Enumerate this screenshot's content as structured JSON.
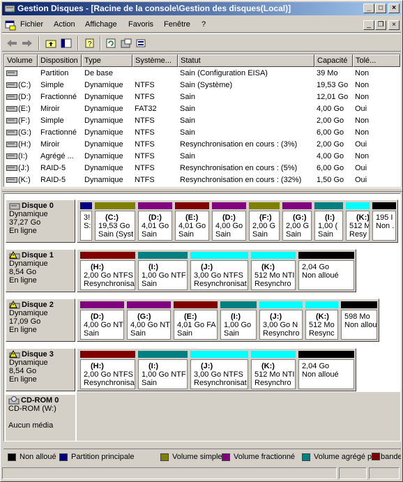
{
  "window": {
    "title": "Gestion Disques - [Racine de la console\\Gestion des disques(Local)]"
  },
  "menu": [
    "Fichier",
    "Action",
    "Affichage",
    "Favoris",
    "Fenêtre",
    "?"
  ],
  "columns": [
    "Volume",
    "Disposition",
    "Type",
    "Système...",
    "Statut",
    "Capacité",
    "Tolé..."
  ],
  "volumes": [
    {
      "volume": "",
      "disposition": "Partition",
      "type": "De base",
      "fs": "",
      "status": "Sain (Configuration EISA)",
      "capacity": "39 Mo",
      "tol": "Non"
    },
    {
      "volume": "(C:)",
      "disposition": "Simple",
      "type": "Dynamique",
      "fs": "NTFS",
      "status": "Sain (Système)",
      "capacity": "19,53 Go",
      "tol": "Non"
    },
    {
      "volume": "(D:)",
      "disposition": "Fractionné",
      "type": "Dynamique",
      "fs": "NTFS",
      "status": "Sain",
      "capacity": "12,01 Go",
      "tol": "Non"
    },
    {
      "volume": "(E:)",
      "disposition": "Miroir",
      "type": "Dynamique",
      "fs": "FAT32",
      "status": "Sain",
      "capacity": "4,00 Go",
      "tol": "Oui"
    },
    {
      "volume": "(F:)",
      "disposition": "Simple",
      "type": "Dynamique",
      "fs": "NTFS",
      "status": "Sain",
      "capacity": "2,00 Go",
      "tol": "Non"
    },
    {
      "volume": "(G:)",
      "disposition": "Fractionné",
      "type": "Dynamique",
      "fs": "NTFS",
      "status": "Sain",
      "capacity": "6,00 Go",
      "tol": "Non"
    },
    {
      "volume": "(H:)",
      "disposition": "Miroir",
      "type": "Dynamique",
      "fs": "NTFS",
      "status": "Resynchronisation en cours : (3%)",
      "capacity": "2,00 Go",
      "tol": "Oui"
    },
    {
      "volume": "(I:)",
      "disposition": "Agrégé ...",
      "type": "Dynamique",
      "fs": "NTFS",
      "status": "Sain",
      "capacity": "4,00 Go",
      "tol": "Non"
    },
    {
      "volume": "(J:)",
      "disposition": "RAID-5",
      "type": "Dynamique",
      "fs": "NTFS",
      "status": "Resynchronisation en cours : (5%)",
      "capacity": "6,00 Go",
      "tol": "Oui"
    },
    {
      "volume": "(K:)",
      "disposition": "RAID-5",
      "type": "Dynamique",
      "fs": "NTFS",
      "status": "Resynchronisation en cours : (32%)",
      "capacity": "1,50 Go",
      "tol": "Oui"
    }
  ],
  "colors": {
    "navy": "#000080",
    "olive": "#808000",
    "purple": "#800080",
    "maroon": "#800000",
    "teal": "#008080",
    "cyan": "#00ffff",
    "black": "#000000"
  },
  "disks": [
    {
      "name": "Disque 0",
      "type": "Dynamique",
      "size": "37,27 Go",
      "state": "En ligne",
      "icon": "disk-icon",
      "partitions": [
        {
          "color": "navy",
          "name": "",
          "size": "3!",
          "status": "S:"
        },
        {
          "color": "olive",
          "name": "(C:)",
          "size": "19,53 Go",
          "status": "Sain (Syst"
        },
        {
          "color": "purple",
          "name": "(D:)",
          "size": "4,01 Go",
          "status": "Sain"
        },
        {
          "color": "maroon",
          "name": "(E:)",
          "size": "4,01 Go",
          "status": "Sain"
        },
        {
          "color": "purple",
          "name": "(D:)",
          "size": "4,00 Go",
          "status": "Sain"
        },
        {
          "color": "olive",
          "name": "(F:)",
          "size": "2,00 G",
          "status": "Sain"
        },
        {
          "color": "purple",
          "name": "(G:)",
          "size": "2,00 G",
          "status": "Sain"
        },
        {
          "color": "teal",
          "name": "(I:)",
          "size": "1,00 (",
          "status": "Sain"
        },
        {
          "color": "cyan",
          "name": "(K:)",
          "size": "512 M",
          "status": "Resy"
        },
        {
          "color": "black",
          "name": "",
          "size": "195 I",
          "status": "Non ."
        }
      ]
    },
    {
      "name": "Disque 1",
      "type": "Dynamique",
      "size": "8,54 Go",
      "state": "En ligne",
      "icon": "warning-disk-icon",
      "partitions": [
        {
          "color": "maroon",
          "name": "(H:)",
          "size": "2,00 Go NTFS",
          "status": "Resynchronisa"
        },
        {
          "color": "teal",
          "name": "(I:)",
          "size": "1,00 Go NTF",
          "status": "Sain"
        },
        {
          "color": "cyan",
          "name": "(J:)",
          "size": "3,00 Go NTFS",
          "status": "Resynchronisat"
        },
        {
          "color": "cyan",
          "name": "(K:)",
          "size": "512 Mo NTI",
          "status": "Resynchro"
        },
        {
          "color": "black",
          "name": "",
          "size": "2,04 Go",
          "status": "Non alloué"
        }
      ]
    },
    {
      "name": "Disque 2",
      "type": "Dynamique",
      "size": "17,09 Go",
      "state": "En ligne",
      "icon": "warning-disk-icon",
      "partitions": [
        {
          "color": "purple",
          "name": "(D:)",
          "size": "4,00 Go NT",
          "status": "Sain"
        },
        {
          "color": "purple",
          "name": "(G:)",
          "size": "4,00 Go NT",
          "status": "Sain"
        },
        {
          "color": "maroon",
          "name": "(E:)",
          "size": "4,01 Go FA",
          "status": "Sain"
        },
        {
          "color": "teal",
          "name": "(I:)",
          "size": "1,00 Go",
          "status": "Sain"
        },
        {
          "color": "cyan",
          "name": "(J:)",
          "size": "3,00 Go N",
          "status": "Resynchro"
        },
        {
          "color": "cyan",
          "name": "(K:)",
          "size": "512 Mo",
          "status": "Resync"
        },
        {
          "color": "black",
          "name": "",
          "size": "598 Mo",
          "status": "Non allou"
        }
      ]
    },
    {
      "name": "Disque 3",
      "type": "Dynamique",
      "size": "8,54 Go",
      "state": "En ligne",
      "icon": "warning-disk-icon",
      "partitions": [
        {
          "color": "maroon",
          "name": "(H:)",
          "size": "2,00 Go NTFS",
          "status": "Resynchronisa"
        },
        {
          "color": "teal",
          "name": "(I:)",
          "size": "1,00 Go NTF",
          "status": "Sain"
        },
        {
          "color": "cyan",
          "name": "(J:)",
          "size": "3,00 Go NTFS",
          "status": "Resynchronisat"
        },
        {
          "color": "cyan",
          "name": "(K:)",
          "size": "512 Mo NTI",
          "status": "Resynchro"
        },
        {
          "color": "black",
          "name": "",
          "size": "2,04 Go",
          "status": "Non alloué"
        }
      ]
    }
  ],
  "cdrom": {
    "name": "CD-ROM 0",
    "drive": "CD-ROM (W:)",
    "media": "Aucun média",
    "icon": "cdrom-icon"
  },
  "legend": [
    {
      "color": "black",
      "label": "Non alloué"
    },
    {
      "color": "navy",
      "label": "Partition principale"
    },
    {
      "color": "olive",
      "label": "Volume simple"
    },
    {
      "color": "purple",
      "label": "Volume fractionné"
    },
    {
      "color": "teal",
      "label": "Volume agrégé par bandes"
    },
    {
      "color": "maroon",
      "label": ""
    }
  ]
}
